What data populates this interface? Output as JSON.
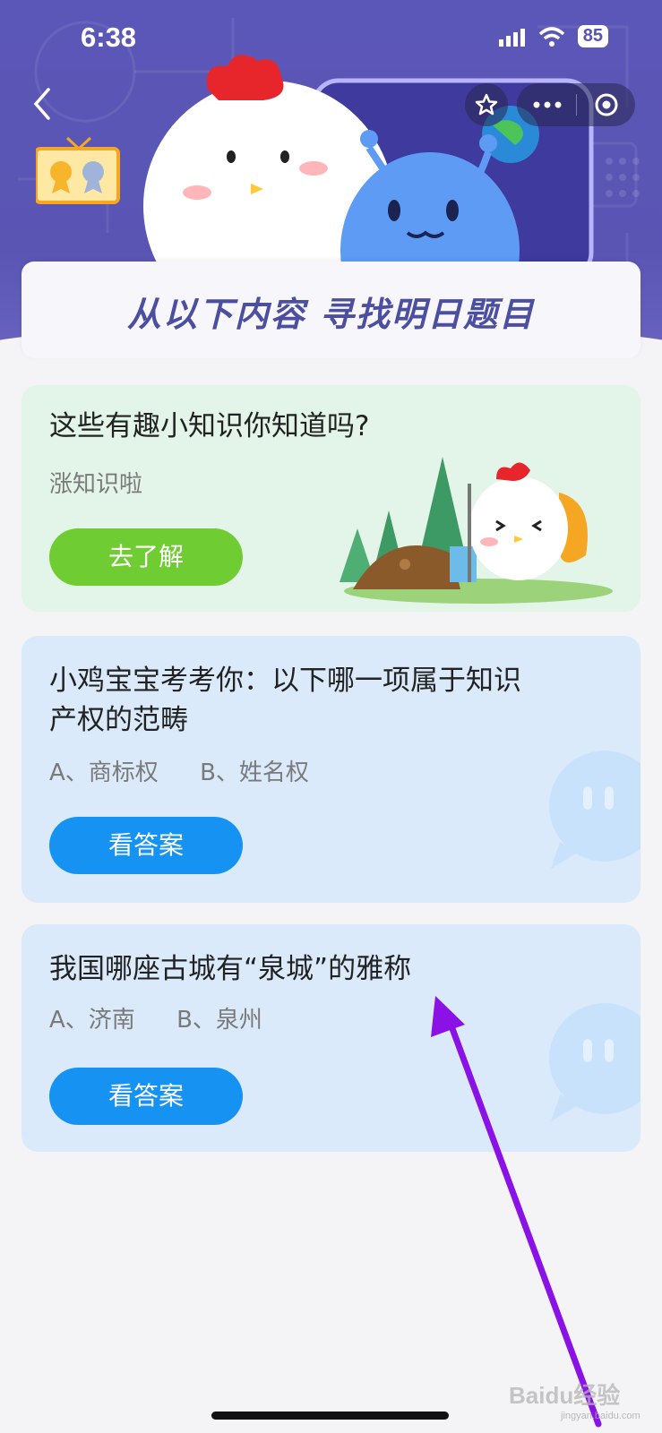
{
  "status_bar": {
    "time": "6:38",
    "battery": "85"
  },
  "header": {
    "banner_title": "从以下内容  寻找明日题目"
  },
  "cards": [
    {
      "title": "这些有趣小知识你知道吗?",
      "subtitle": "涨知识啦",
      "button": "去了解"
    },
    {
      "title_line1": "小鸡宝宝考考你：以下哪一项属于知识",
      "title_line2": "产权的范畴",
      "option_a": "A、商标权",
      "option_b": "B、姓名权",
      "button": "看答案"
    },
    {
      "title": "我国哪座古城有“泉城”的雅称",
      "option_a": "A、济南",
      "option_b": "B、泉州",
      "button": "看答案"
    }
  ],
  "watermark": {
    "brand": "Baidu经验",
    "domain": "jingyan.baidu.com"
  },
  "colors": {
    "header_bg": "#5a55b3",
    "green_button": "#6fcc32",
    "blue_button": "#1592f2",
    "arrow": "#8a12e6"
  }
}
